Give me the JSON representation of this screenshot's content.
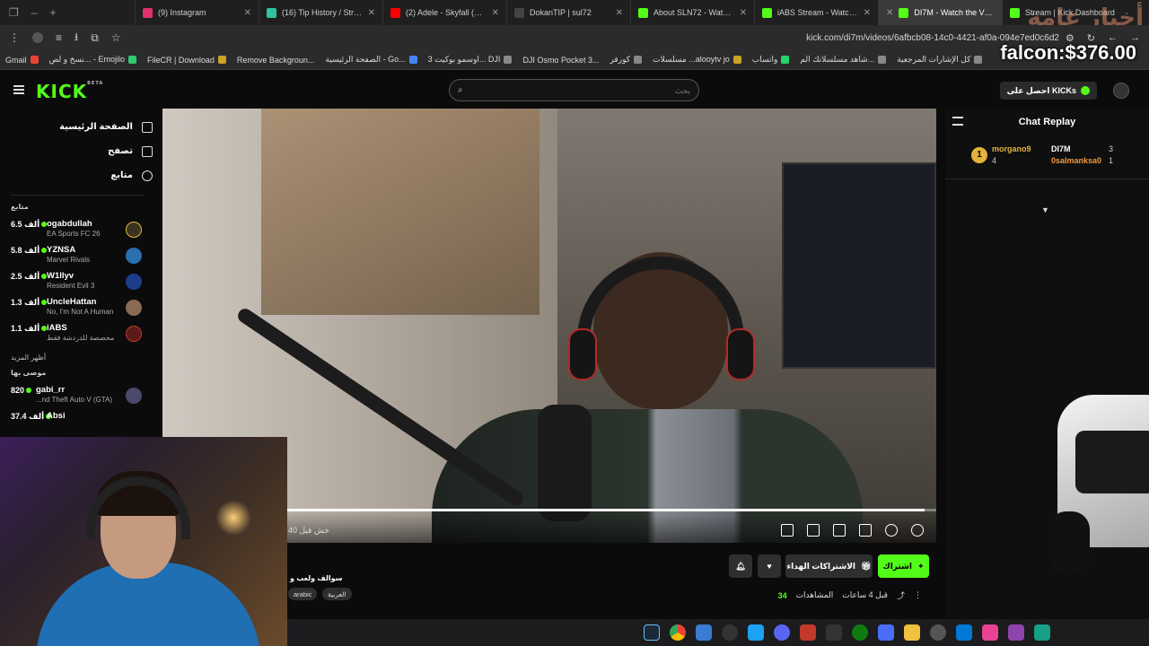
{
  "browser": {
    "tabs": [
      {
        "label": "(9) Instagram",
        "color": "#e1306c"
      },
      {
        "label": "(16) Tip History / Streaml",
        "color": "#31c3a2"
      },
      {
        "label": "(2) Adele - Skyfall (Officia",
        "color": "#ff0000"
      },
      {
        "label": "DokanTIP | sul72",
        "color": "#444444"
      },
      {
        "label": "About SLN72 - Watch Liv",
        "color": "#53fc18"
      },
      {
        "label": "iABS Stream - Watch Live",
        "color": "#53fc18"
      },
      {
        "label": "DI7M - Watch the VOD",
        "color": "#53fc18",
        "active": true
      },
      {
        "label": "Stream | Kick Dashboard",
        "color": "#53fc18"
      }
    ],
    "url": "kick.com/di7m/videos/6afbcb08-14c0-4421-af0a-094e7ed0c6d2",
    "bookmarks": [
      "كل الإشارات المرجعية",
      "شاهد مسلسلاتك الم...",
      "واتساب",
      "مسلسلات ...alooytv jo",
      "كورفر",
      "DJI Osmo Pocket 3...",
      "اوسمو بوكيت 3... DJI",
      "الصفحة الرئيسية - Go...",
      "Remove Backgroun...",
      "FileCR | Download",
      "نسخ و لص... - Emojilo",
      "Gmail"
    ]
  },
  "overlays": {
    "price": "falcon:$376.00",
    "arabic_watermark": "أخبار عامة"
  },
  "header": {
    "logo": "KICK",
    "logo_badge": "BETA",
    "search_placeholder": "بحث",
    "get_kicks": "احصل على KICKs"
  },
  "sidebar": {
    "nav": [
      {
        "label": "الصفحة الرئيسية",
        "icon": "home-icon"
      },
      {
        "label": "تصفح",
        "icon": "browse-icon"
      },
      {
        "label": "متابع",
        "icon": "heart-icon"
      }
    ],
    "following_title": "متابع",
    "following": [
      {
        "name": "ogabdullah",
        "game": "EA Sports FC 26",
        "count": "6.5 ألف"
      },
      {
        "name": "YZNSA",
        "game": "Marvel Rivals",
        "count": "5.8 ألف"
      },
      {
        "name": "W1llyv",
        "game": "Resident Evil 3",
        "count": "2.5 ألف"
      },
      {
        "name": "UncleHattan",
        "game": "No, I'm Not A Human",
        "count": "1.3 ألف"
      },
      {
        "name": "iABS",
        "game": "مخصصة للدردشة فقط",
        "count": "1.1 ألف"
      }
    ],
    "show_more": "أظهر المزيد",
    "recommended_title": "موصى بها",
    "recommended": [
      {
        "name": "gabi_rr",
        "game": "...nd Theft Auto V (GTA)",
        "count": "820"
      },
      {
        "name": "Absi",
        "game": "",
        "count": "37.4 ألف"
      }
    ]
  },
  "video": {
    "timestamp": "خش قبل 40",
    "progress": 0.985
  },
  "below_video": {
    "subscribe": "اشتراك",
    "gift_subs": "الاشتراكات الهداء",
    "stream_title": "سوالف ولعب و",
    "tags": [
      "arabic",
      "العربية"
    ],
    "time_ago": "قبل 4 ساعات",
    "views_label": "المشاهدات",
    "views": "34"
  },
  "chat": {
    "title": "Chat Replay",
    "leaderboard": [
      {
        "rank": "1",
        "name": "morgano9",
        "count": "4"
      },
      {
        "name": "DI7M",
        "count": "3"
      },
      {
        "name": "0salmanksa0",
        "count": "1"
      }
    ]
  },
  "colors": {
    "accent": "#53fc18",
    "gold": "#e3b33b"
  }
}
